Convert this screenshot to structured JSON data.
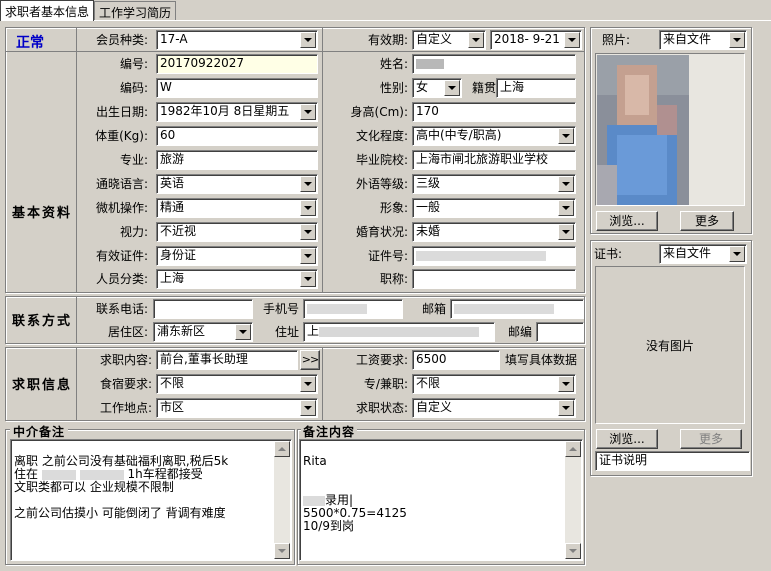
{
  "tabs": [
    "求职者基本信息",
    "工作学习简历"
  ],
  "status": "正常",
  "sections": {
    "basic": "基本资料",
    "contact": "联系方式",
    "job": "求职信息"
  },
  "basic": {
    "member_type_label": "会员种类:",
    "member_type": "17-A",
    "valid_label": "有效期:",
    "valid_mode": "自定义",
    "valid_date": "2018- 9-21",
    "id_label": "编号:",
    "id": "20170922027",
    "name_label": "姓名:",
    "code_label": "编码:",
    "code": "W",
    "gender_label": "性别:",
    "gender": "女",
    "native_label": "籍贯",
    "native": "上海",
    "birth_label": "出生日期:",
    "birth": "1982年10月 8日星期五",
    "height_label": "身高(Cm):",
    "height": "170",
    "weight_label": "体重(Kg):",
    "weight": "60",
    "edu_label": "文化程度:",
    "edu": "高中(中专/职高)",
    "major_label": "专业:",
    "major": "旅游",
    "school_label": "毕业院校:",
    "school": "上海市闸北旅游职业学校",
    "lang_label": "通晓语言:",
    "lang": "英语",
    "lang_level_label": "外语等级:",
    "lang_level": "三级",
    "computer_label": "微机操作:",
    "computer": "精通",
    "image_label": "形象:",
    "image": "一般",
    "vision_label": "视力:",
    "vision": "不近视",
    "marital_label": "婚育状况:",
    "marital": "未婚",
    "cert_label": "有效证件:",
    "cert": "身份证",
    "cert_no_label": "证件号:",
    "category_label": "人员分类:",
    "category": "上海",
    "title_label": "职称:"
  },
  "contact": {
    "phone_label": "联系电话:",
    "mobile_label": "手机号",
    "email_label": "邮箱",
    "district_label": "居住区:",
    "district": "浦东新区",
    "address_label": "住址",
    "address_prefix": "上",
    "zip_label": "邮编"
  },
  "job": {
    "content_label": "求职内容:",
    "content": "前台,董事长助理",
    "more": ">>",
    "salary_label": "工资要求:",
    "salary": "6500",
    "salary_hint": "填写具体数据",
    "board_label": "食宿要求:",
    "board": "不限",
    "parttime_label": "专/兼职:",
    "parttime": "不限",
    "location_label": "工作地点:",
    "location": "市区",
    "status_label": "求职状态:",
    "status": "自定义"
  },
  "notes": {
    "agent_title": "中介备注",
    "agent_text_1": "离职 之前公司没有基础福利离职,税后5k",
    "agent_text_2_prefix": "住在",
    "agent_text_2_suffix": "1h车程都接受",
    "agent_text_3": "文职类都可以 企业规模不限制",
    "agent_text_4": "之前公司估摸小 可能倒闭了 背调有难度",
    "remark_title": "备注内容",
    "remark_1": "Rita",
    "remark_2": "录用|",
    "remark_3": "5500*0.75=4125",
    "remark_4": "10/9到岗"
  },
  "photo": {
    "label": "照片:",
    "source": "来自文件",
    "browse": "浏览...",
    "more": "更多"
  },
  "certificate": {
    "label": "证书:",
    "source": "来自文件",
    "empty": "没有图片",
    "browse": "浏览...",
    "more": "更多",
    "desc": "证书说明"
  }
}
